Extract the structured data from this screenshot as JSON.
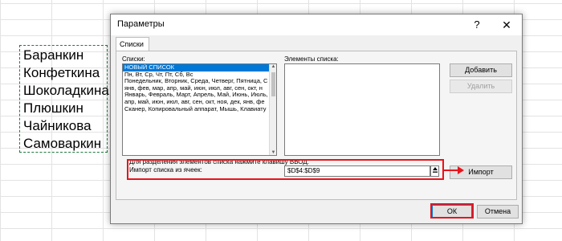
{
  "sheet": {
    "names": [
      "Баранкин",
      "Конфеткина",
      "Шоколадкина",
      "Плюшкин",
      "Чайникова",
      "Самоваркин"
    ]
  },
  "dialog": {
    "title": "Параметры",
    "help_label": "?",
    "close_label": "✕",
    "tab_label": "Списки",
    "lists_label": "Списки:",
    "entries_label": "Элементы списка:",
    "lists": [
      "НОВЫЙ СПИСОК",
      "Пн, Вт, Ср, Чт, Пт, Сб, Вс",
      "Понедельник, Вторник, Среда, Четверг, Пятница, С",
      "янв, фев, мар, апр, май, июн, июл, авг, сен, окт, н",
      "Январь, Февраль, Март, Апрель, Май, Июнь, Июль, ",
      "апр, май, июн, июл, авг, сен, окт, ноя, дек, янв, фе",
      "Сканер, Копировальный аппарат, Мышь, Клавиату"
    ],
    "selected_index": 0,
    "add_button": "Добавить",
    "delete_button": "Удалить",
    "hint": "Для разделения элементов списка нажмите клавишу ВВОД.",
    "import_label": "Импорт списка из ячеек:",
    "import_value": "$D$4:$D$9",
    "import_button": "Импорт",
    "ok_button": "ОК",
    "cancel_button": "Отмена"
  },
  "colors": {
    "highlight": "#e8141b",
    "selection": "#0078d7",
    "marching_ants": "#1e7b3e"
  },
  "icons": {
    "collapse": "collapse-dialog-icon",
    "arrow": "arrow-right-icon"
  }
}
